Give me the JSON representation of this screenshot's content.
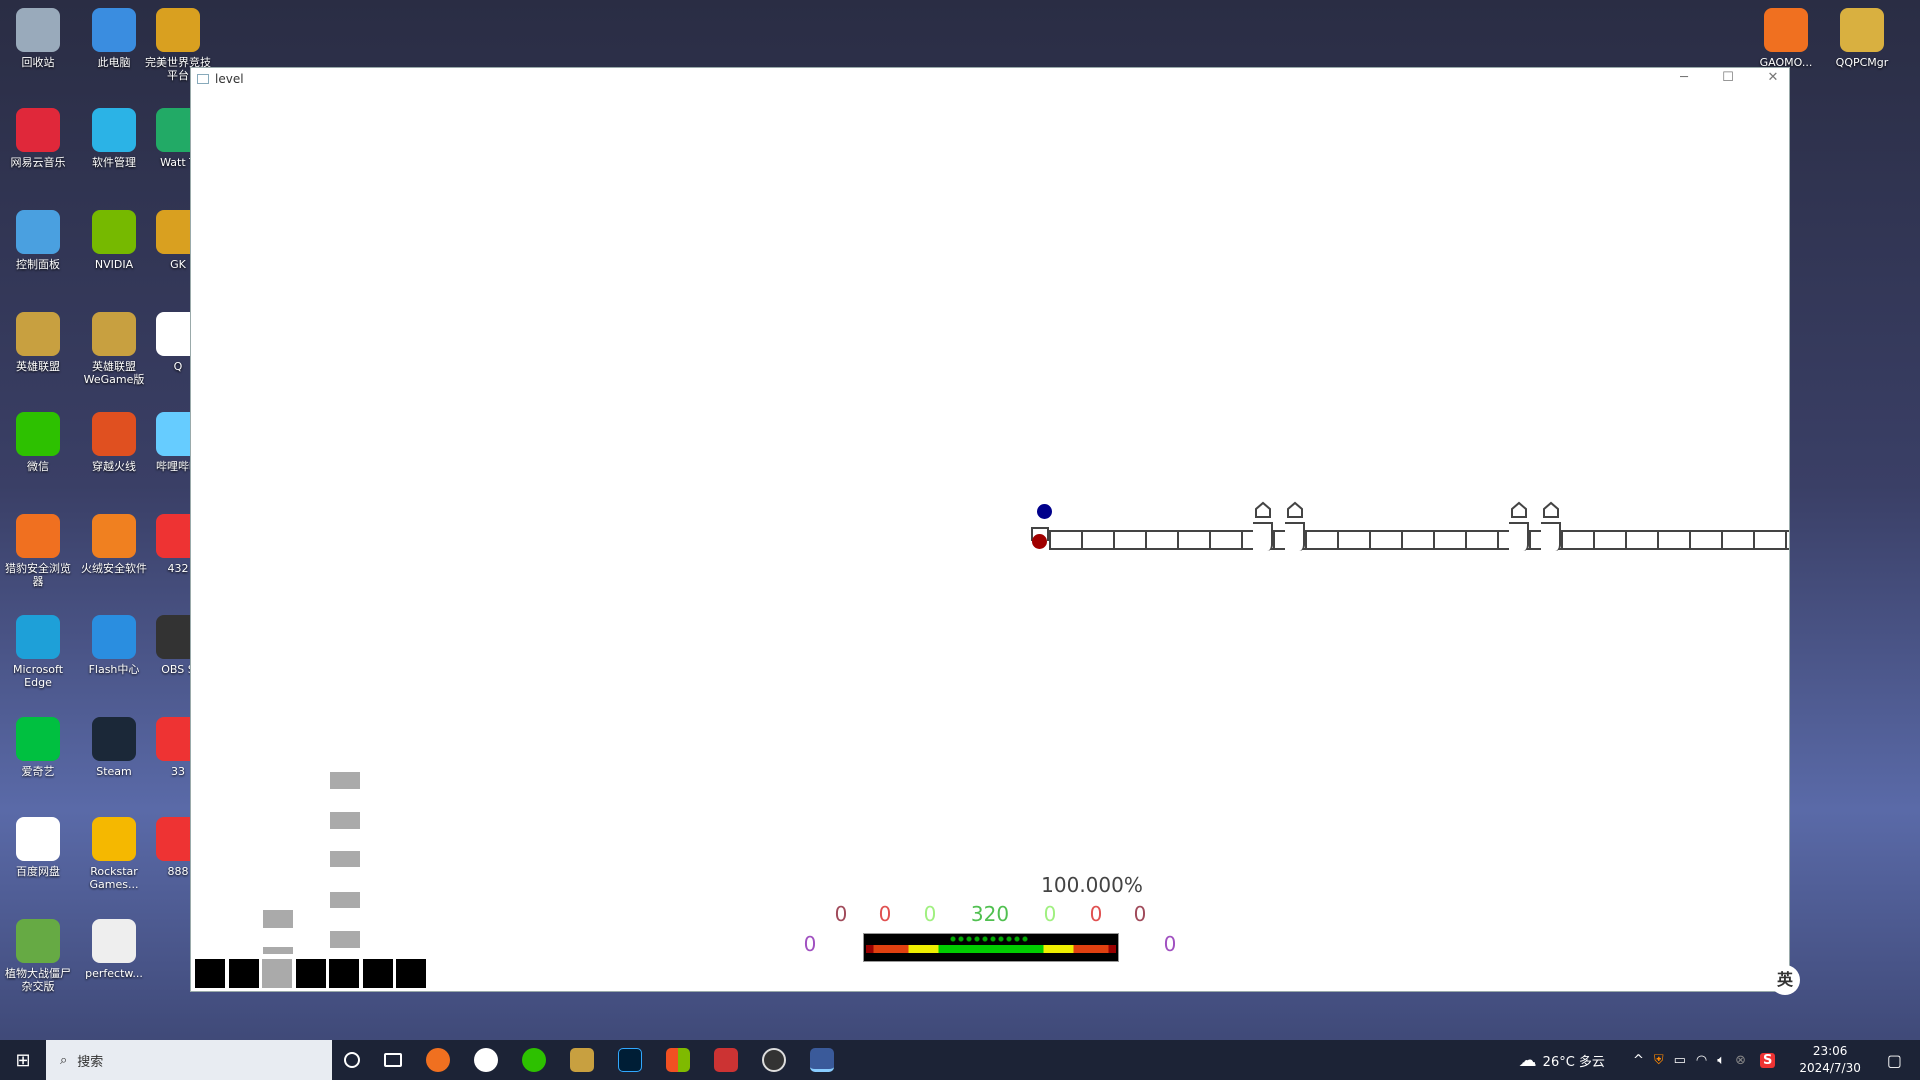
{
  "desktop": {
    "icons": [
      {
        "label": "回收站",
        "color": "#9ab"
      },
      {
        "label": "此电脑",
        "color": "#3a8de0"
      },
      {
        "label": "完美世界竞技平台",
        "color": "#d9a020"
      },
      {
        "label": "网易云音乐",
        "color": "#e0283a"
      },
      {
        "label": "软件管理",
        "color": "#2bb3e6"
      },
      {
        "label": "Watt T",
        "color": "#2a6"
      },
      {
        "label": "控制面板",
        "color": "#4aa0e0"
      },
      {
        "label": "NVIDIA",
        "color": "#76b900"
      },
      {
        "label": "GK",
        "color": "#d9a020"
      },
      {
        "label": "英雄联盟",
        "color": "#c8a040"
      },
      {
        "label": "英雄联盟WeGame版",
        "color": "#c8a040"
      },
      {
        "label": "Q",
        "color": "#fff"
      },
      {
        "label": "微信",
        "color": "#2dc100"
      },
      {
        "label": "穿越火线",
        "color": "#e05020"
      },
      {
        "label": "哔哩哔哩",
        "color": "#6cf"
      },
      {
        "label": "猎豹安全浏览器",
        "color": "#f07020"
      },
      {
        "label": "火绒安全软件",
        "color": "#f08020"
      },
      {
        "label": "432",
        "color": "#e33"
      },
      {
        "label": "Microsoft Edge",
        "color": "#1ea0d8"
      },
      {
        "label": "Flash中心",
        "color": "#2a8ee0"
      },
      {
        "label": "OBS S",
        "color": "#333"
      },
      {
        "label": "爱奇艺",
        "color": "#00c040"
      },
      {
        "label": "Steam",
        "color": "#1b2838"
      },
      {
        "label": "33",
        "color": "#e33"
      },
      {
        "label": "百度网盘",
        "color": "#fff"
      },
      {
        "label": "Rockstar Games...",
        "color": "#f5b800"
      },
      {
        "label": "888",
        "color": "#e33"
      },
      {
        "label": "植物大战僵尸杂交版",
        "color": "#6a4"
      },
      {
        "label": "perfectw...",
        "color": "#eee"
      }
    ],
    "right_icons": [
      {
        "label": "GAOMO...",
        "color": "#f07020"
      },
      {
        "label": "QQPCMgr",
        "color": "#d9b040"
      }
    ]
  },
  "window": {
    "title": "level",
    "minimize": "─",
    "maximize": "☐",
    "close": "✕"
  },
  "game": {
    "accuracy": "100.000%",
    "judgements": [
      {
        "v": "0",
        "c": "#a04a5a"
      },
      {
        "v": "0",
        "c": "#e05050"
      },
      {
        "v": "0",
        "c": "#a0f080"
      },
      {
        "v": "320",
        "c": "#50c050"
      },
      {
        "v": "0",
        "c": "#a0f080"
      },
      {
        "v": "0",
        "c": "#e05050"
      },
      {
        "v": "0",
        "c": "#a04a5a"
      }
    ],
    "early_miss": "0",
    "late_miss": "0",
    "miss_color": "#a050c0",
    "player_colors": {
      "blue": "#00008b",
      "red": "#a00000"
    },
    "tile_count": 29,
    "bottom_blocks": [
      "black",
      "black",
      "gray",
      "black",
      "black",
      "black",
      "black"
    ]
  },
  "taskbar": {
    "search_placeholder": "搜索",
    "weather": "26°C 多云",
    "time": "23:06",
    "date": "2024/7/30",
    "ime": "英"
  }
}
